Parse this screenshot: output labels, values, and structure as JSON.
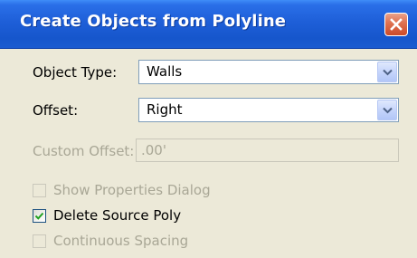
{
  "dialog": {
    "title": "Create Objects from Polyline"
  },
  "object_type": {
    "label": "Object Type:",
    "value": "Walls"
  },
  "offset": {
    "label": "Offset:",
    "value": "Right"
  },
  "custom_offset": {
    "label": "Custom Offset:",
    "value": ".00'",
    "enabled": false
  },
  "options": [
    {
      "label": "Show Properties Dialog",
      "checked": false,
      "enabled": false
    },
    {
      "label": "Delete Source Poly",
      "checked": true,
      "enabled": true
    },
    {
      "label": "Continuous Spacing",
      "checked": false,
      "enabled": false
    }
  ],
  "colors": {
    "titlebar": "#1e5fd8",
    "dialog_bg": "#ECE9D8",
    "check_mark": "#21a121",
    "disabled_text": "#a9a796"
  }
}
